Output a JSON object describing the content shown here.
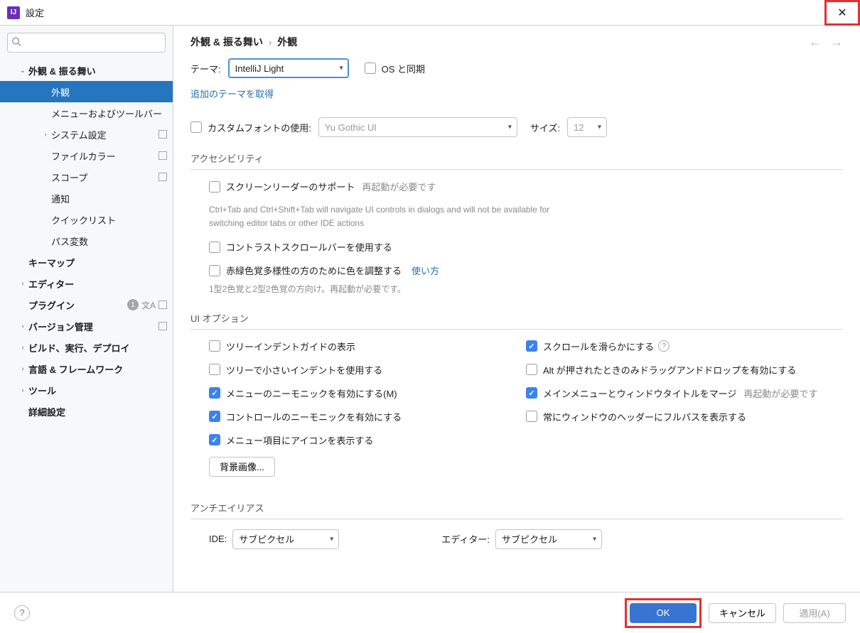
{
  "window": {
    "title": "設定"
  },
  "breadcrumb": {
    "root": "外観 & 振る舞い",
    "current": "外観"
  },
  "sidebar": {
    "items": [
      {
        "label": "外観 & 振る舞い",
        "indent": 1,
        "arrow": "down",
        "bold": true
      },
      {
        "label": "外観",
        "indent": 2,
        "selected": true
      },
      {
        "label": "メニューおよびツールバー",
        "indent": 2
      },
      {
        "label": "システム設定",
        "indent": 2,
        "arrow": "right",
        "box": true
      },
      {
        "label": "ファイルカラー",
        "indent": 2,
        "box": true
      },
      {
        "label": "スコープ",
        "indent": 2,
        "box": true
      },
      {
        "label": "通知",
        "indent": 2
      },
      {
        "label": "クイックリスト",
        "indent": 2
      },
      {
        "label": "パス変数",
        "indent": 2
      },
      {
        "label": "キーマップ",
        "indent": 1,
        "bold": true
      },
      {
        "label": "エディター",
        "indent": 1,
        "arrow": "right",
        "bold": true
      },
      {
        "label": "プラグイン",
        "indent": 1,
        "bold": true,
        "badge": "1",
        "lang": true,
        "box": true
      },
      {
        "label": "バージョン管理",
        "indent": 1,
        "arrow": "right",
        "bold": true,
        "box": true
      },
      {
        "label": "ビルド、実行、デプロイ",
        "indent": 1,
        "arrow": "right",
        "bold": true
      },
      {
        "label": "言語 & フレームワーク",
        "indent": 1,
        "arrow": "right",
        "bold": true
      },
      {
        "label": "ツール",
        "indent": 1,
        "arrow": "right",
        "bold": true
      },
      {
        "label": "詳細設定",
        "indent": 1,
        "bold": true
      }
    ]
  },
  "theme": {
    "label": "テーマ:",
    "value": "IntelliJ Light",
    "sync_label": "OS と同期",
    "more_link": "追加のテーマを取得"
  },
  "font": {
    "use_label": "カスタムフォントの使用:",
    "value": "Yu Gothic UI",
    "size_label": "サイズ:",
    "size_value": "12"
  },
  "accessibility": {
    "title": "アクセシビリティ",
    "screen_reader": "スクリーンリーダーのサポート",
    "screen_reader_hint": "再起動が必要です",
    "screen_reader_desc": "Ctrl+Tab and Ctrl+Shift+Tab will navigate UI controls in dialogs and will not be available for switching editor tabs or other IDE actions",
    "contrast_scroll": "コントラストスクロールバーを使用する",
    "color_adjust": "赤緑色覚多様性の方のために色を調整する",
    "color_howto": "使い方",
    "color_desc": "1型2色覚と2型2色覚の方向け。再起動が必要です。"
  },
  "ui_options": {
    "title": "UI オプション",
    "indent_guides": "ツリーインデントガイドの表示",
    "small_indent": "ツリーで小さいインデントを使用する",
    "menu_mnemonic": "メニューのニーモニックを有効にする(M)",
    "control_mnemonic": "コントロールのニーモニックを有効にする",
    "menu_icons": "メニュー項目にアイコンを表示する",
    "smooth_scroll": "スクロールを滑らかにする",
    "alt_drag": "Alt が押されたときのみドラッグアンドドロップを有効にする",
    "merge_title": "メインメニューとウィンドウタイトルをマージ",
    "merge_hint": "再起動が必要です",
    "fullpath_header": "常にウィンドウのヘッダーにフルパスを表示する",
    "bg_image_btn": "背景画像..."
  },
  "antialias": {
    "title": "アンチエイリアス",
    "ide_label": "IDE:",
    "ide_value": "サブピクセル",
    "editor_label": "エディター:",
    "editor_value": "サブピクセル"
  },
  "footer": {
    "ok": "OK",
    "cancel": "キャンセル",
    "apply": "適用(A)"
  }
}
